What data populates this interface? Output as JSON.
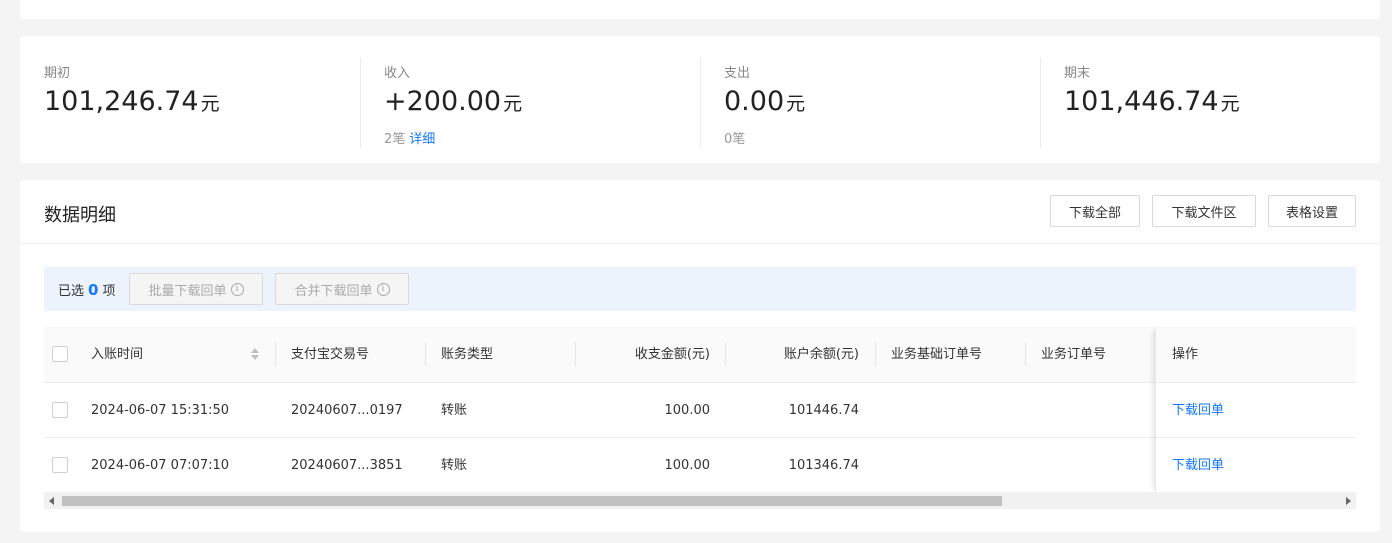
{
  "summary": {
    "opening": {
      "label": "期初",
      "value": "101,246.74",
      "unit": "元"
    },
    "income": {
      "label": "收入",
      "value": "+200.00",
      "unit": "元",
      "count": "2笔",
      "detail_link": "详细"
    },
    "expense": {
      "label": "支出",
      "value": "0.00",
      "unit": "元",
      "count": "0笔"
    },
    "closing": {
      "label": "期末",
      "value": "101,446.74",
      "unit": "元"
    }
  },
  "detail": {
    "title": "数据明细",
    "buttons": {
      "download_all": "下载全部",
      "download_files": "下载文件区",
      "table_settings": "表格设置"
    }
  },
  "selection": {
    "prefix": "已选",
    "count": "0",
    "suffix": "项",
    "batch_download": "批量下载回单",
    "merge_download": "合并下载回单"
  },
  "table": {
    "columns": {
      "time": "入账时间",
      "trade_no": "支付宝交易号",
      "type": "账务类型",
      "amount": "收支金额(元)",
      "balance": "账户余额(元)",
      "base_order": "业务基础订单号",
      "order": "业务订单号",
      "action": "操作"
    },
    "rows": [
      {
        "time": "2024-06-07 15:31:50",
        "trade_no": "20240607...0197",
        "type": "转账",
        "amount": "100.00",
        "balance": "101446.74",
        "base_order": "",
        "order": "",
        "action": "下载回单"
      },
      {
        "time": "2024-06-07 07:07:10",
        "trade_no": "20240607...3851",
        "type": "转账",
        "amount": "100.00",
        "balance": "101346.74",
        "base_order": "",
        "order": "",
        "action": "下载回单"
      }
    ]
  }
}
